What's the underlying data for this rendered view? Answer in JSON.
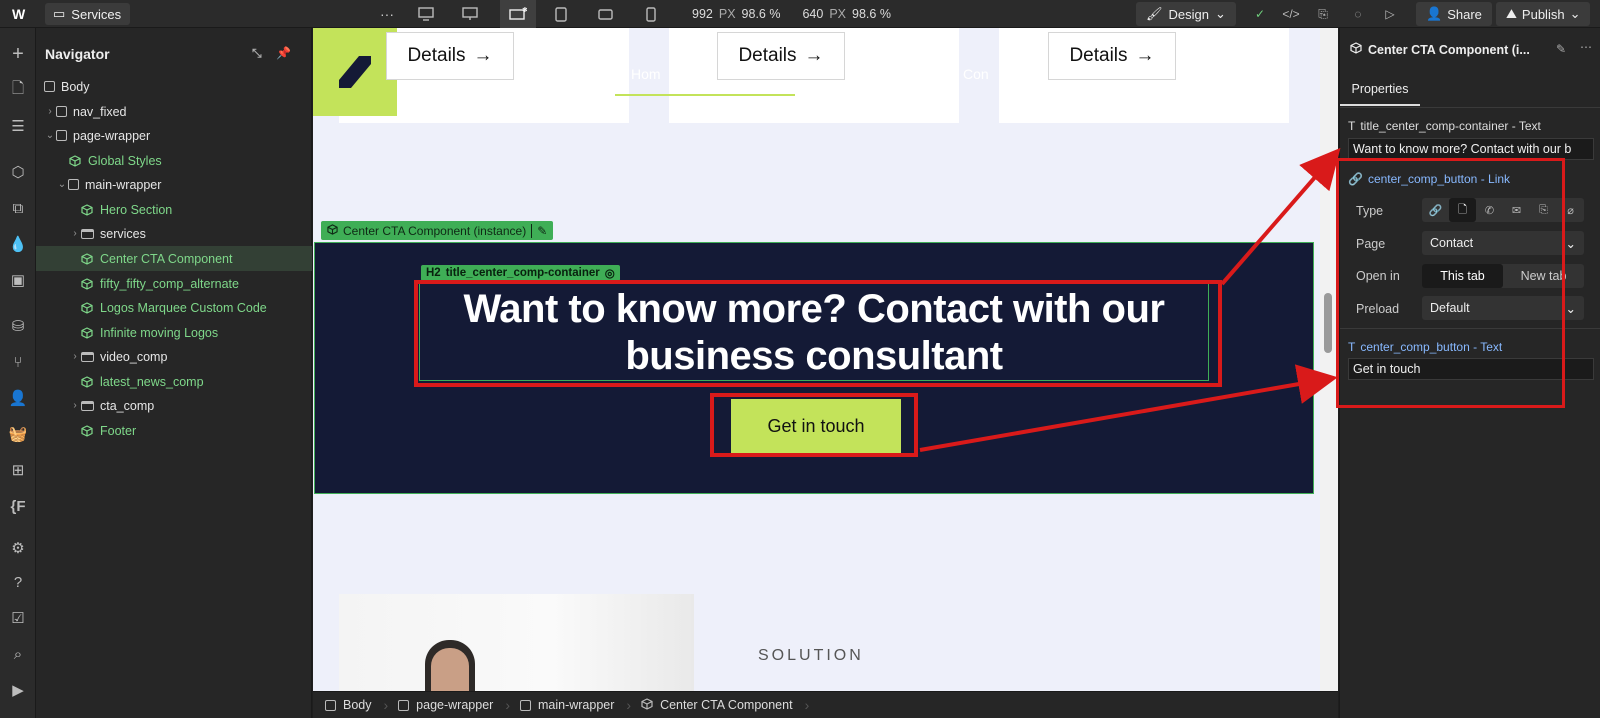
{
  "topbar": {
    "logo": "W",
    "page_tab": "Services",
    "more": "···",
    "width_value": "992",
    "width_unit": "PX",
    "width_zoom": "98.6 %",
    "height_value": "640",
    "height_unit": "PX",
    "height_zoom": "98.6 %",
    "mode_label": "Design",
    "share_label": "Share",
    "publish_label": "Publish"
  },
  "navigator": {
    "title": "Navigator",
    "items": [
      {
        "label": "Body"
      },
      {
        "label": "nav_fixed"
      },
      {
        "label": "page-wrapper"
      },
      {
        "label": "Global Styles"
      },
      {
        "label": "main-wrapper"
      },
      {
        "label": "Hero Section"
      },
      {
        "label": "services"
      },
      {
        "label": "Center CTA Component"
      },
      {
        "label": "fifty_fifty_comp_alternate"
      },
      {
        "label": "Logos Marquee Custom Code"
      },
      {
        "label": "Infinite moving Logos"
      },
      {
        "label": "video_comp"
      },
      {
        "label": "latest_news_comp"
      },
      {
        "label": "cta_comp"
      },
      {
        "label": "Footer"
      }
    ]
  },
  "canvas": {
    "details_label": "Details",
    "ghost_nav_1": "Hom",
    "ghost_nav_2": "Con",
    "instance_label": "Center CTA Component (instance)",
    "h2_tag": "H2",
    "h2_label": "title_center_comp-container",
    "cta_title": "Want to know more? Contact with our business consultant",
    "cta_button": "Get in touch",
    "solution_label": "SOLUTION"
  },
  "breadcrumb": {
    "items": [
      {
        "label": "Body"
      },
      {
        "label": "page-wrapper"
      },
      {
        "label": "main-wrapper"
      },
      {
        "label": "Center CTA Component"
      }
    ]
  },
  "properties": {
    "title": "Center CTA Component (i...",
    "tab": "Properties",
    "section_title": "title_center_comp-container - Text",
    "title_value": "Want to know more? Contact with our b",
    "section_link": "center_comp_button - Link",
    "type_label": "Type",
    "page_label": "Page",
    "page_value": "Contact",
    "open_label": "Open in",
    "open_this": "This tab",
    "open_new": "New tab",
    "preload_label": "Preload",
    "preload_value": "Default",
    "section_text": "center_comp_button - Text",
    "text_value": "Get in touch"
  },
  "colors": {
    "accent": "#c3e35a",
    "cta_bg": "#141a36",
    "selection_green": "#3fae56",
    "annotation_red": "#d91a1a"
  }
}
